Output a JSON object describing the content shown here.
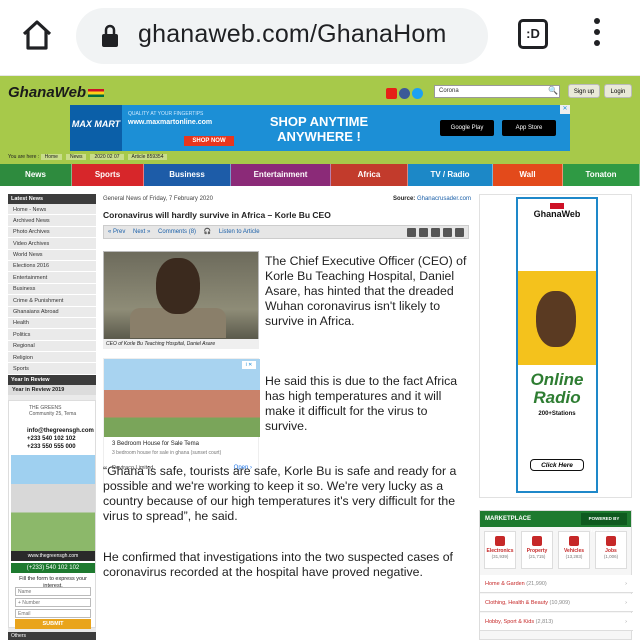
{
  "browser": {
    "url": "ghanaweb.com/GhanaHom",
    "tab_count": ":D"
  },
  "site": {
    "logo": "GhanaWeb",
    "search_value": "Corona",
    "signup": "Sign up",
    "login": "Login",
    "banner": {
      "brand": "MAX MART",
      "tag": "QUALITY AT YOUR FINGERTIPS",
      "url": "www.maxmartonline.com",
      "shop_now": "SHOP NOW",
      "headline": "SHOP ANYTIME ANYWHERE !",
      "google_play": "Google Play",
      "app_store": "App Store"
    },
    "breadcrumb": {
      "prefix": "You are here :",
      "items": [
        "Home",
        "News",
        "2020 02 07",
        "Article 859354"
      ]
    },
    "nav": [
      "News",
      "Sports",
      "Business",
      "Entertainment",
      "Africa",
      "TV / Radio",
      "Wall",
      "Tonaton"
    ],
    "colors": {
      "header_green": "#a7c94a",
      "news": "#2e8b3e",
      "sports": "#d7262a",
      "business": "#1d5ca8",
      "entertainment": "#8b2a78",
      "africa": "#c23b2c",
      "tvradio": "#1c88c7",
      "wall": "#e34a1b",
      "tonaton": "#2f9a44"
    }
  },
  "sidebar": {
    "latest_news": "Latest News",
    "items": [
      "Home - News",
      "Archived News",
      "Photo Archives",
      "Video Archives",
      "World News",
      "Elections 2016",
      "Entertainment",
      "Business",
      "Crime & Punishment",
      "Ghanaians Abroad",
      "Health",
      "Politics",
      "Regional",
      "Religion",
      "Sports"
    ],
    "year_in_review": "Year In Review",
    "year_in_review_item": "Year in Review 2019",
    "ad": {
      "brand": "THE GREENS",
      "tagline": "Community 25, Tema",
      "email": "info@thegreensgh.com",
      "phone1": "+233 540 102 102",
      "phone2": "+233 550 555 000",
      "website": "www.thegreensgh.com",
      "phone_bar": "(+233) 540 102 102",
      "fill_form": "Fill the form to express your interest.",
      "name_placeholder": "Name",
      "number_placeholder": "+ Number",
      "email_placeholder": "Email",
      "submit": "SUBMIT"
    },
    "others": "Others"
  },
  "article": {
    "category_date": "General News of Friday, 7 February 2020",
    "source_label": "Source:",
    "source": "Ghanacrusader.com",
    "title": "Coronavirus will hardly survive in Africa – Korle Bu CEO",
    "toolbar": {
      "prev": "« Prev",
      "next": "Next »",
      "comments": "Comments (8)",
      "listen": "Listen to Article"
    },
    "photo_caption": "CEO of Korle Bu Teaching Hospital, Daniel Asare",
    "paragraphs": [
      "The Chief Executive Officer (CEO) of Korle Bu Teaching Hospital, Daniel Asare, has hinted that the dreaded Wuhan coronavirus isn't likely to survive in Africa.",
      "He said this is due to the fact Africa has high temperatures and it will make it difficult for the virus to survive.",
      "“Ghana is safe, tourists are safe, Korle Bu is safe and ready for a possible and we're working to keep it so. We're very lucky as a country because of our high temperatures it's very difficult for the virus to spread”, he said.",
      "He confirmed that investigations into the two suspected cases of coronavirus recorded at the hospital have proved negative."
    ],
    "ad": {
      "title": "3 Bedroom House for Sale Tema",
      "subtitle": "3 bedroom house for sale in ghana (sunset court)",
      "brand": "Devtraco Limited",
      "open": "Open ›"
    }
  },
  "right": {
    "radio_ad": {
      "brand": "GhanaWeb",
      "title": "Online Radio",
      "stations": "200+Stations",
      "click": "Click Here"
    },
    "marketplace": {
      "title": "MARKETPLACE",
      "powered": "POWERED BY Tonaton.com",
      "categories": [
        {
          "label": "Electronics",
          "count": "(31,939)"
        },
        {
          "label": "Property",
          "count": "(21,715)"
        },
        {
          "label": "Vehicles",
          "count": "(13,283)"
        },
        {
          "label": "Jobs",
          "count": "(1,006)"
        }
      ],
      "rows": [
        {
          "label": "Home & Garden",
          "count": "(21,990)"
        },
        {
          "label": "Clothing, Health & Beauty",
          "count": "(10,909)"
        },
        {
          "label": "Hobby, Sport & Kids",
          "count": "(2,813)"
        }
      ]
    }
  }
}
